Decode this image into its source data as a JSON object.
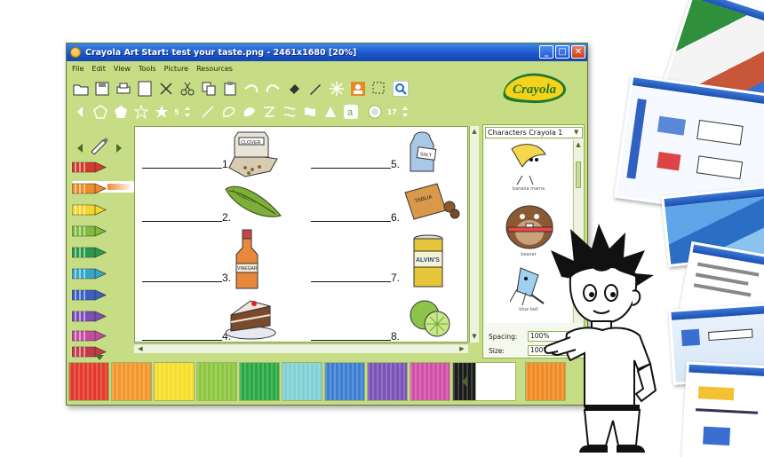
{
  "window": {
    "title": "Crayola Art Start: test your taste.png - 2461x1680 [20%]",
    "min_label": "_",
    "max_label": "□",
    "close_label": "✕"
  },
  "menu": [
    "File",
    "Edit",
    "View",
    "Tools",
    "Picture",
    "Resources"
  ],
  "logo_text": "Crayola",
  "toolbar1_icons": [
    "open-folder-icon",
    "save-icon",
    "print-icon",
    "new-page-icon",
    "scissors-cut-icon",
    "cut-icon",
    "copy-icon",
    "paste-icon",
    "undo-icon",
    "redo-icon",
    "fill-icon",
    "pencil-icon",
    "sparkle-icon",
    "stamp-icon",
    "select-icon",
    "zoom-icon"
  ],
  "toolbar2": {
    "shape_count": "5",
    "size_value": "17"
  },
  "canvas": {
    "numbers": [
      "1.",
      "2.",
      "3.",
      "4.",
      "5.",
      "6.",
      "7.",
      "8."
    ],
    "labels": {
      "clover": "CLOVER",
      "salt": "SALT",
      "tablia": "TABLIA",
      "vinegar": "VINEGAR",
      "alvins": "ALVIN'S"
    }
  },
  "gallery": {
    "selected": "Characters Crayola 1",
    "captions": [
      "banana mama",
      "beaver",
      "blue bell"
    ],
    "spacing_label": "Spacing:",
    "spacing_value": "100%",
    "size_label": "Size:",
    "size_value": "100%"
  },
  "palette_colors": [
    "#e23b2b",
    "#f3962c",
    "#f6de2a",
    "#8dc63f",
    "#29a845",
    "#7fd1d6",
    "#3c7fd1",
    "#7b52b8",
    "#d24fa7",
    "#1a1a1a",
    "#ffffff",
    "#f08a24"
  ],
  "crayon_colors": [
    "#d43a2c",
    "#f08b2c",
    "#f4d52a",
    "#7ebd3a",
    "#2a9a48",
    "#35a6c9",
    "#3a5fc0",
    "#7b4db5",
    "#c44b9e",
    "#c43a4a"
  ]
}
